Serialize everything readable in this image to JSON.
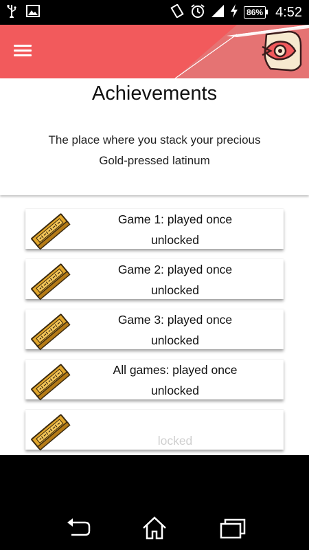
{
  "status_bar": {
    "left_icons": [
      "usb-icon",
      "image-icon"
    ],
    "right_icons": [
      "vibrate-icon",
      "alarm-icon",
      "signal-icon",
      "charging-icon"
    ],
    "battery": "86%",
    "time": "4:52"
  },
  "app_bar": {
    "color": "#f25a5c",
    "menu_icon": "hamburger-menu-icon",
    "logo_icon": "app-logo-icon"
  },
  "header": {
    "title": "Achievements",
    "subtitle_line1": "The place where you stack your precious",
    "subtitle_line2": "Gold-pressed latinum"
  },
  "achievements": [
    {
      "title": "Game 1: played once",
      "status": "unlocked",
      "icon": "latinum-bar-icon"
    },
    {
      "title": "Game 2: played once",
      "status": "unlocked",
      "icon": "latinum-bar-icon"
    },
    {
      "title": "Game 3: played once",
      "status": "unlocked",
      "icon": "latinum-bar-icon"
    },
    {
      "title": "All games: played once",
      "status": "unlocked",
      "icon": "latinum-bar-icon"
    },
    {
      "title": "",
      "status": "locked",
      "icon": "latinum-bar-icon"
    }
  ],
  "nav_bar": {
    "buttons": [
      "back-icon",
      "home-icon",
      "recent-apps-icon"
    ]
  }
}
